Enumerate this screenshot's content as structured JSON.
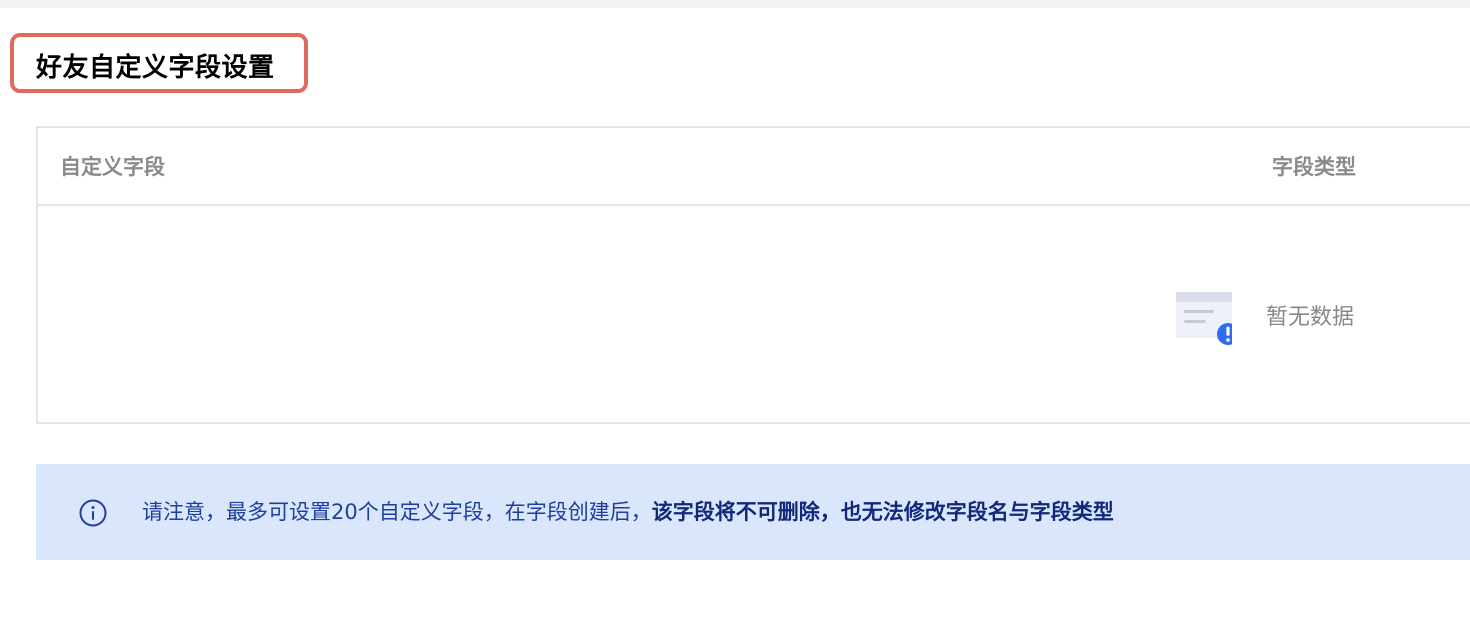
{
  "page": {
    "title": "好友自定义字段设置"
  },
  "table": {
    "columns": [
      "自定义字段",
      "字段类型"
    ],
    "rows": [],
    "empty_text": "暂无数据"
  },
  "notice": {
    "text_plain": "请注意，最多可设置20个自定义字段，在字段创建后，",
    "text_bold": "该字段将不可删除，也无法修改字段名与字段类型"
  },
  "icons": {
    "empty_state": "empty-data-icon",
    "notice": "info-icon"
  },
  "colors": {
    "highlight_border": "#e06a5e",
    "notice_background": "#d9e6fb",
    "notice_text": "#1f3f9e",
    "empty_badge": "#2f6cf0"
  }
}
